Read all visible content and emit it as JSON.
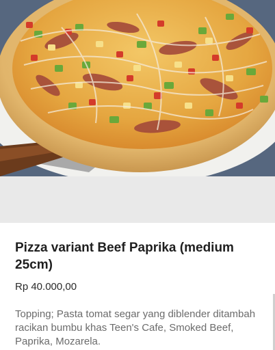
{
  "product": {
    "image_alt": "pizza-photo",
    "title": "Pizza variant Beef Paprika (medium 25cm)",
    "price": "Rp 40.000,00",
    "description": "Topping; Pasta tomat segar yang diblender ditambah racikan bumbu khas Teen's Cafe, Smoked Beef, Paprika, Mozarela."
  },
  "colors": {
    "title": "#1f1f1f",
    "price": "#2a2a2a",
    "description": "#6b6b6b",
    "gap": "#e9e9e9"
  }
}
